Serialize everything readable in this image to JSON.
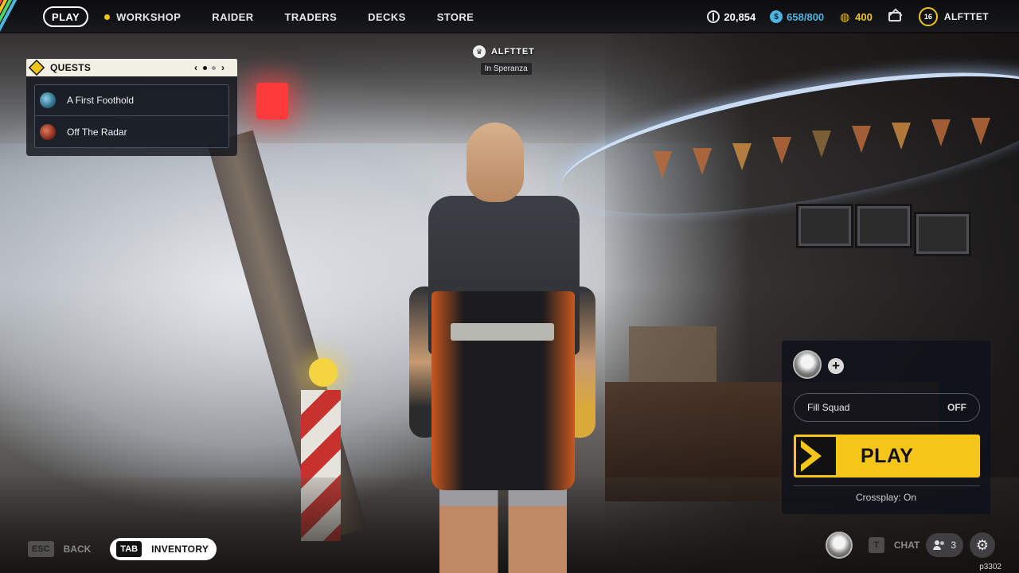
{
  "nav": {
    "items": [
      {
        "label": "PLAY",
        "active": true
      },
      {
        "label": "WORKSHOP",
        "dot": true
      },
      {
        "label": "RAIDER"
      },
      {
        "label": "TRADERS"
      },
      {
        "label": "DECKS"
      },
      {
        "label": "STORE"
      }
    ]
  },
  "currencies": {
    "credits": "20,854",
    "cred_cap": "658/800",
    "coins": "400"
  },
  "profile": {
    "level": "16",
    "username": "ALFTTET"
  },
  "player_tag": {
    "name": "ALFTTET",
    "location": "In Speranza"
  },
  "quests": {
    "title": "QUESTS",
    "page_prev": "‹",
    "page_next": "›",
    "items": [
      {
        "name": "A First Foothold",
        "icon": "quest-globe-icon"
      },
      {
        "name": "Off The Radar",
        "icon": "quest-bomb-icon"
      }
    ]
  },
  "squad": {
    "add_label": "+",
    "fill_squad_label": "Fill Squad",
    "fill_squad_value": "OFF",
    "play_label": "PLAY",
    "crossplay": "Crossplay: On"
  },
  "bottom": {
    "esc_key": "ESC",
    "back_label": "BACK",
    "tab_key": "TAB",
    "inventory_label": "INVENTORY",
    "chat_key": "T",
    "chat_label": "CHAT",
    "friends_count": "3",
    "build": "p3302"
  },
  "colors": {
    "accent": "#f5c518",
    "credits_blue": "#4fb4e0",
    "panel_bg": "#10121a"
  }
}
